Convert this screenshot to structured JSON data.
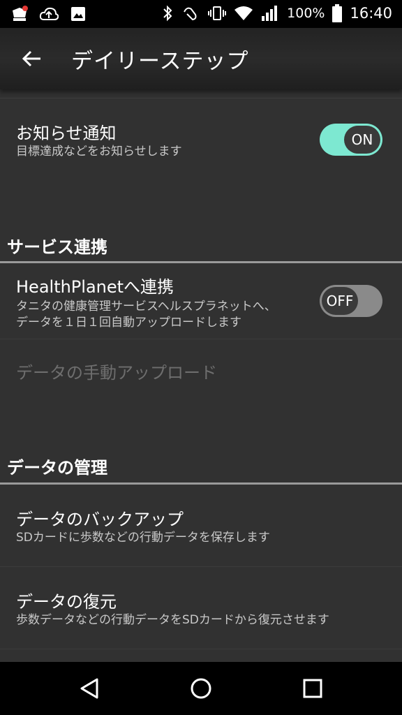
{
  "status_bar": {
    "battery_percent": "100%",
    "time": "16:40",
    "icons": [
      "app-notification-icon",
      "cloud-upload-icon",
      "image-icon",
      "bluetooth-icon",
      "nfc-icon",
      "vibrate-icon",
      "wifi-icon",
      "signal-icon",
      "battery-icon"
    ]
  },
  "app_bar": {
    "title": "デイリーステップ",
    "back_icon": "arrow-back-icon"
  },
  "notification": {
    "title": "お知らせ通知",
    "subtitle": "目標達成などをお知らせします",
    "toggle_label": "ON",
    "toggle_state": "on"
  },
  "section_service": {
    "header": "サービス連携",
    "healthplanet": {
      "title": "HealthPlanetへ連携",
      "subtitle_line1": "タニタの健康管理サービスヘルスプラネットへ、",
      "subtitle_line2": "データを１日１回自動アップロードします",
      "toggle_label": "OFF",
      "toggle_state": "off"
    },
    "manual_upload": {
      "title": "データの手動アップロード",
      "enabled": false
    }
  },
  "section_data": {
    "header": "データの管理",
    "backup": {
      "title": "データのバックアップ",
      "subtitle": "SDカードに歩数などの行動データを保存します"
    },
    "restore": {
      "title": "データの復元",
      "subtitle": "歩数データなどの行動データをSDカードから復元させます"
    }
  },
  "nav_bar": {
    "icons": [
      "back-triangle-icon",
      "home-circle-icon",
      "recents-square-icon"
    ]
  },
  "colors": {
    "accent": "#7de8d1",
    "background": "#313131",
    "toggle_off": "#8a8a8a"
  }
}
